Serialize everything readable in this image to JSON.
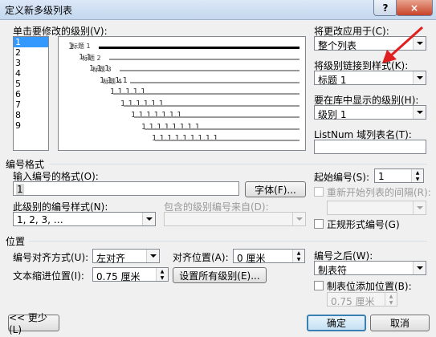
{
  "window": {
    "title": "定义新多级列表",
    "help_label": "?",
    "close_label": "×"
  },
  "left": {
    "level_list_label": "单击要修改的级别(V):",
    "levels": [
      "1",
      "2",
      "3",
      "4",
      "5",
      "6",
      "7",
      "8",
      "9"
    ],
    "preview": [
      {
        "text": "1",
        "title": "标题 1"
      },
      {
        "text": "1.1",
        "title": "标题 2"
      },
      {
        "text": "1.1.1",
        "title": "标题 3"
      },
      {
        "text": "1.1.1.1",
        "title": "标题 4"
      },
      {
        "text": "1.1.1.1.1",
        "title": ""
      },
      {
        "text": "1.1.1.1.1.1",
        "title": ""
      },
      {
        "text": "1.1.1.1.1.1.1",
        "title": ""
      },
      {
        "text": "1.1.1.1.1.1.1.1",
        "title": ""
      },
      {
        "text": "1.1.1.1.1.1.1.1.1",
        "title": ""
      }
    ]
  },
  "right": {
    "apply_to_label": "将更改应用于(C):",
    "apply_to_value": "整个列表",
    "link_style_label": "将级别链接到样式(K):",
    "link_style_value": "标题 1",
    "gallery_level_label": "要在库中显示的级别(H):",
    "gallery_level_value": "级别 1",
    "listnum_label": "ListNum 域列表名(T):",
    "listnum_value": ""
  },
  "number_format": {
    "section_label": "编号格式",
    "format_input_label": "输入编号的格式(O):",
    "format_value": "1",
    "font_button": "字体(F)...",
    "style_label": "此级别的编号样式(N):",
    "style_value": "1, 2, 3, …",
    "include_label": "包含的级别编号来自(D):",
    "include_value": "",
    "start_at_label": "起始编号(S):",
    "start_at_value": "1",
    "restart_label": "重新开始列表的间隔(R):",
    "restart_value": "",
    "legal_label": "正规形式编号(G)"
  },
  "position": {
    "section_label": "位置",
    "alignment_label": "编号对齐方式(U):",
    "alignment_value": "左对齐",
    "aligned_at_label": "对齐位置(A):",
    "aligned_at_value": "0 厘米",
    "indent_label": "文本缩进位置(I):",
    "indent_value": "0.75 厘米",
    "set_all_button": "设置所有级别(E)...",
    "follow_label": "编号之后(W):",
    "follow_value": "制表符",
    "add_tab_label": "制表位添加位置(B):",
    "tab_value": "0.75 厘米"
  },
  "footer": {
    "less_button": "<< 更少(L)",
    "ok_button": "确定",
    "cancel_button": "取消"
  }
}
